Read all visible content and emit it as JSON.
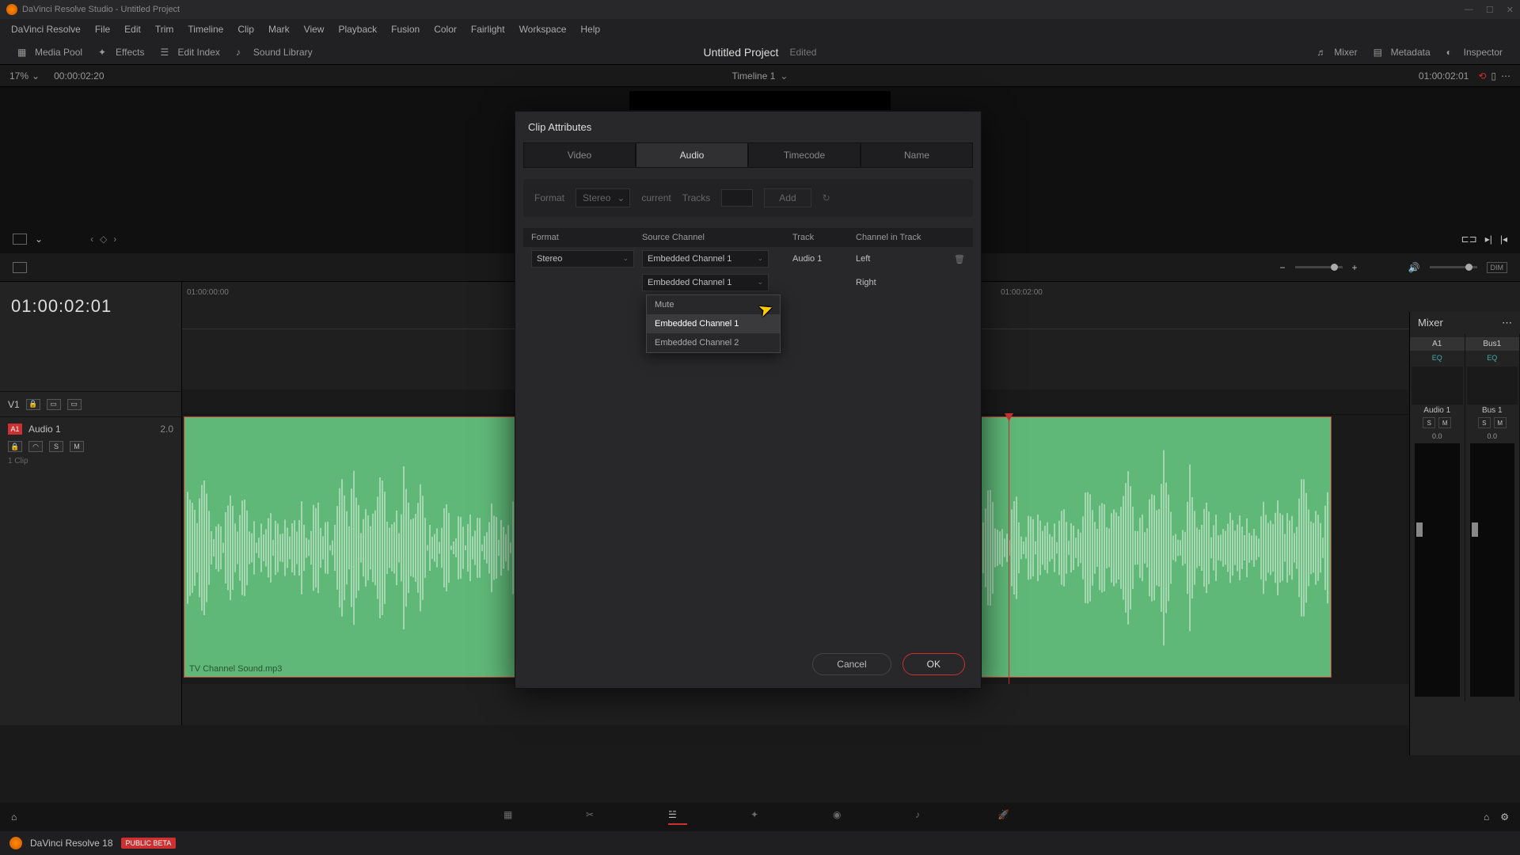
{
  "titlebar": {
    "text": "DaVinci Resolve Studio - Untitled Project"
  },
  "menu": [
    "DaVinci Resolve",
    "File",
    "Edit",
    "Trim",
    "Timeline",
    "Clip",
    "Mark",
    "View",
    "Playback",
    "Fusion",
    "Color",
    "Fairlight",
    "Workspace",
    "Help"
  ],
  "toolbar": {
    "left": [
      {
        "icon": "media-pool-icon",
        "label": "Media Pool"
      },
      {
        "icon": "effects-icon",
        "label": "Effects"
      },
      {
        "icon": "edit-index-icon",
        "label": "Edit Index"
      },
      {
        "icon": "sound-library-icon",
        "label": "Sound Library"
      }
    ],
    "project": "Untitled Project",
    "status": "Edited",
    "right": [
      {
        "icon": "mixer-icon",
        "label": "Mixer"
      },
      {
        "icon": "metadata-icon",
        "label": "Metadata"
      },
      {
        "icon": "inspector-icon",
        "label": "Inspector"
      }
    ]
  },
  "tlheader": {
    "zoom": "17%",
    "tc_left": "00:00:02:20",
    "timeline_name": "Timeline 1",
    "tc_right": "01:00:02:01"
  },
  "bigtc": "01:00:02:01",
  "ruler": {
    "t0": "01:00:00:00",
    "t1": "01:00:02:00"
  },
  "tracks": {
    "video": "V1",
    "audio_id": "A1",
    "audio_name": "Audio 1",
    "audio_ch": "2.0",
    "clips": "1 Clip"
  },
  "clip": {
    "name": "TV Channel Sound.mp3"
  },
  "mixer": {
    "title": "Mixer",
    "cols": [
      {
        "label": "A1",
        "name": "Audio 1",
        "eq": "EQ",
        "db": "0.0"
      },
      {
        "label": "Bus1",
        "name": "Bus 1",
        "eq": "EQ",
        "db": "0.0"
      }
    ],
    "sm": [
      "S",
      "M"
    ],
    "dim": "DIM"
  },
  "modal": {
    "title": "Clip Attributes",
    "tabs": [
      "Video",
      "Audio",
      "Timecode",
      "Name"
    ],
    "active_tab": 1,
    "addrow": {
      "format_lbl": "Format",
      "format_val": "Stereo",
      "tracks_lbl": "Tracks",
      "add_btn": "Add"
    },
    "headers": [
      "Format",
      "Source Channel",
      "Track",
      "Channel in Track"
    ],
    "row": {
      "format": "Stereo",
      "src1": "Embedded Channel 1",
      "src2": "Embedded Channel 1",
      "track": "Audio 1",
      "ch1": "Left",
      "ch2": "Right"
    },
    "dropdown": [
      "Mute",
      "Embedded Channel 1",
      "Embedded Channel 2"
    ],
    "cancel": "Cancel",
    "ok": "OK"
  },
  "taskbar": {
    "app": "DaVinci Resolve 18",
    "beta": "PUBLIC BETA"
  }
}
